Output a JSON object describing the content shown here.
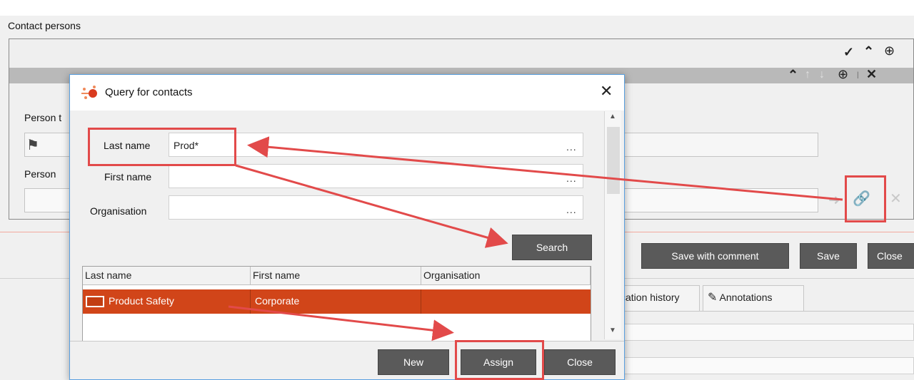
{
  "background": {
    "section_title": "Contact persons",
    "person_label_1": "Person t",
    "person_label_2": "Person",
    "buttons": {
      "save_with_comment": "Save with comment",
      "save": "Save",
      "close": "Close"
    },
    "tabs": {
      "history": "cation history",
      "annotations": "Annotations"
    },
    "icons": {
      "expand": "chevron-down",
      "collapse": "chevron-up",
      "add": "plus-circle",
      "remove": "x"
    }
  },
  "dialog": {
    "title": "Query for contacts",
    "fields": {
      "last_name_label": "Last name",
      "last_name_value": "Prod*",
      "first_name_label": "First name",
      "first_name_value": "",
      "organisation_label": "Organisation",
      "organisation_value": "",
      "ellipsis": "..."
    },
    "search_button": "Search",
    "table": {
      "headers": [
        "Last name",
        "First name",
        "Organisation"
      ],
      "rows": [
        {
          "last_name": "Product Safety",
          "first_name": "Corporate",
          "organisation": ""
        }
      ]
    },
    "footer": {
      "new": "New",
      "assign": "Assign",
      "close": "Close"
    }
  },
  "colors": {
    "selection": "#d14519",
    "annotation": "#e24a4a",
    "dialog_border": "#5aa0e0"
  }
}
